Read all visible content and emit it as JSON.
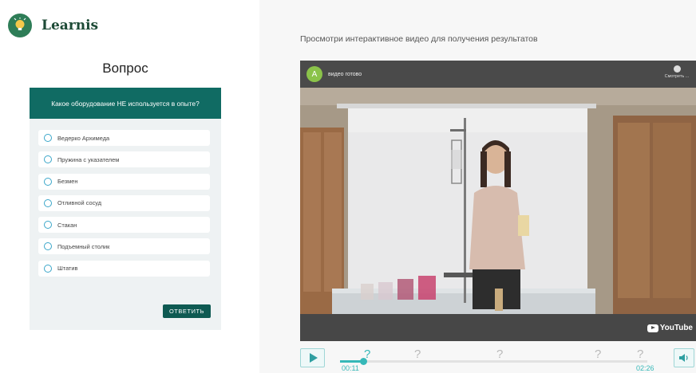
{
  "brand": {
    "name": "Learnis"
  },
  "quiz": {
    "heading": "Вопрос",
    "question": "Какое оборудование НЕ используется в опыте?",
    "options": [
      "Ведерко Архимеда",
      "Пружина с указателем",
      "Безмен",
      "Отливной сосуд",
      "Стакан",
      "Подъемный столик",
      "Штатив"
    ],
    "answer_label": "ОТВЕТИТЬ"
  },
  "video_panel": {
    "instruction": "Просмотри интерактивное видео для получения результатов",
    "channel_initial": "A",
    "video_title": "видео готово",
    "watch_later_label": "Смотреть ...",
    "youtube_label": "YouTube",
    "colors": {
      "accent": "#36b8b8",
      "overlay": "#4a4a4a"
    }
  },
  "player": {
    "markers": [
      "?",
      "?",
      "?",
      "?",
      "?"
    ],
    "current_time": "00:11",
    "duration": "02:26",
    "progress_fraction": 0.075
  }
}
